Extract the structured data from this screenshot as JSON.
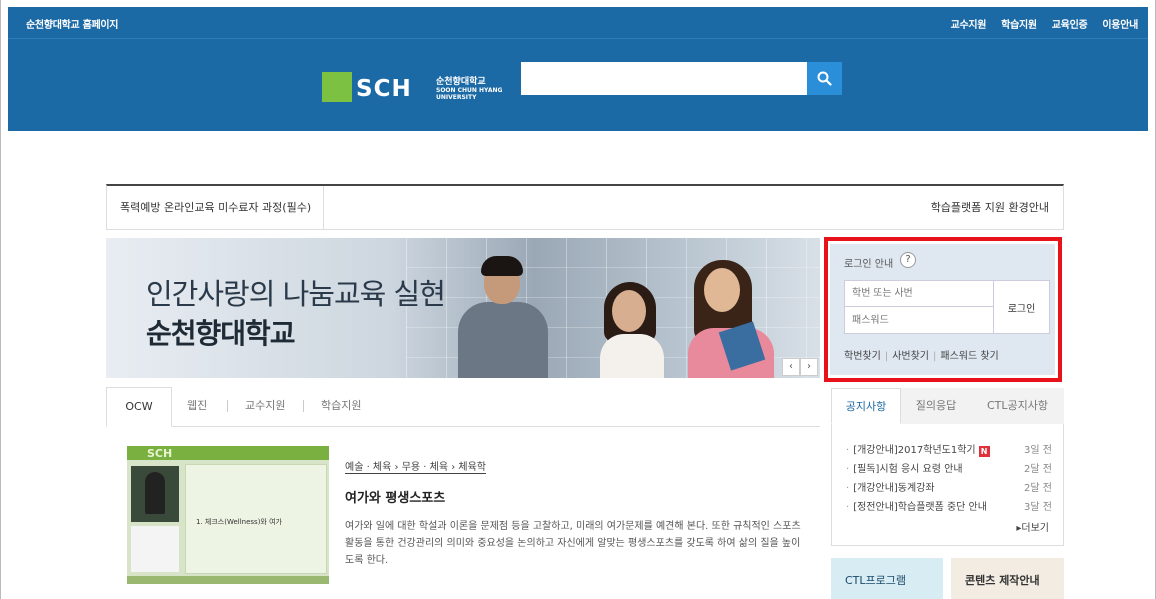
{
  "header": {
    "home_link": "순천향대학교 홈페이지",
    "top_menu": [
      "교수지원",
      "학습지원",
      "교육인증",
      "이용안내"
    ],
    "logo_text": "SCH",
    "logo_kr": "순천향대학교",
    "logo_en": "SOON CHUN HYANG UNIVERSITY",
    "search_value": "",
    "search_icon": "magnifier-icon"
  },
  "notice_bar": {
    "left": "폭력예방 온라인교육 미수료자 과정(필수)",
    "right": "학습플랫폼 지원 환경안내"
  },
  "banner": {
    "line1": "인간사랑의 나눔교육 실현",
    "line2": "순천향대학교",
    "prev": "‹",
    "next": "›"
  },
  "login": {
    "title": "로그인 안내",
    "help": "?",
    "id_placeholder": "학번 또는 사번",
    "pw_placeholder": "패스워드",
    "button": "로그인",
    "links": [
      "학번찾기",
      "사번찾기",
      "패스워드 찾기"
    ]
  },
  "tabs": [
    "OCW",
    "웹진",
    "교수지원",
    "학습지원"
  ],
  "course": {
    "thumb_logo": "SCH",
    "thumb_slide_text": "1. 체크스(Wellness)와 여가",
    "category": "예술 · 체육 › 무용 · 체육 › 체육학",
    "title": "여가와 평생스포츠",
    "description": "여가와 일에 대한 학설과 이론을 문제점 등을 고찰하고, 미래의 여가문제를 예견해 본다. 또한 규칙적인 스포츠활동을 통한 건강관리의 의미와 중요성을 논의하고 자신에게 알맞는 평생스포츠를 갖도록 하여 삶의 질을 높이도록 한다."
  },
  "right_tabs": [
    "공지사항",
    "질의응답",
    "CTL공지사항"
  ],
  "notices": [
    {
      "title": "[개강안내]2017학년도1학기",
      "badge": "N",
      "date": "3일 전"
    },
    {
      "title": "[필독]시험 응시 요령 안내",
      "badge": "",
      "date": "2달 전"
    },
    {
      "title": "[개강안내]동계강좌",
      "badge": "",
      "date": "2달 전"
    },
    {
      "title": "[정전안내]학습플랫폼 중단 안내",
      "badge": "",
      "date": "3달 전"
    }
  ],
  "more": "▸더보기",
  "ctl_program": "CTL프로그램",
  "content_guide": "콘텐츠 제작안내",
  "colors": {
    "header_blue": "#1b6aa5",
    "logo_green": "#7dc142",
    "highlight_red": "#e8121a"
  }
}
